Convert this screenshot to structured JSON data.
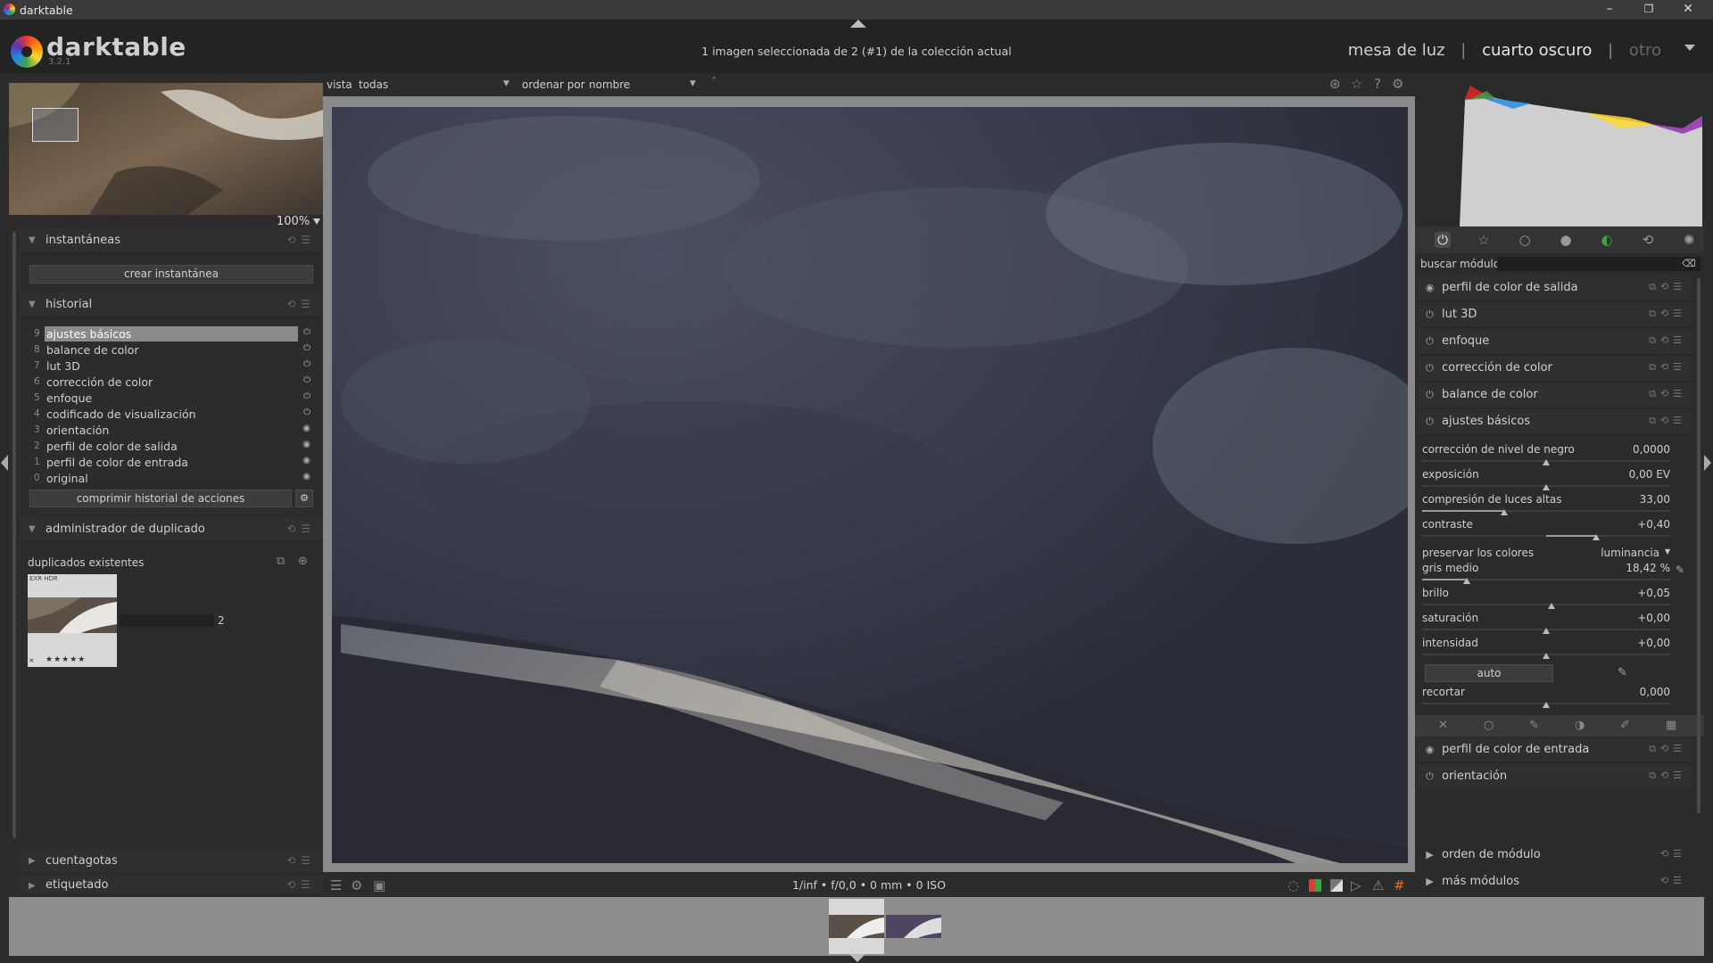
{
  "window": {
    "title": "darktable",
    "min": "–",
    "restore": "❐",
    "close": "✕"
  },
  "header": {
    "brand": "darktable",
    "version": "3.2.1",
    "collection_info": "1 imagen seleccionada de 2 (#1) de la colección actual",
    "views": {
      "lighttable": "mesa de luz",
      "separator": "|",
      "darkroom": "cuarto oscuro",
      "other": "otro"
    }
  },
  "navigator": {
    "zoom": "100%"
  },
  "left": {
    "snapshots": {
      "title": "instantáneas",
      "create_button": "crear instantánea"
    },
    "history": {
      "title": "historial",
      "items": [
        {
          "num": "9",
          "label": "ajustes básicos",
          "selected": true
        },
        {
          "num": "8",
          "label": "balance de color"
        },
        {
          "num": "7",
          "label": "lut 3D"
        },
        {
          "num": "6",
          "label": "corrección de color"
        },
        {
          "num": "5",
          "label": "enfoque"
        },
        {
          "num": "4",
          "label": "codificado de visualización"
        },
        {
          "num": "3",
          "label": "orientación"
        },
        {
          "num": "2",
          "label": "perfil de color de salida"
        },
        {
          "num": "1",
          "label": "perfil de color de entrada"
        },
        {
          "num": "0",
          "label": "original"
        }
      ],
      "compress_button": "comprimir historial de acciones"
    },
    "duplicates": {
      "title": "administrador de duplicado",
      "existing": "duplicados existentes",
      "thumb_tag": "EXR HDR",
      "count": "2",
      "stars": "★★★★★",
      "reject": "×"
    },
    "eyedropper": {
      "title": "cuentagotas"
    },
    "tagging": {
      "title": "etiquetado"
    }
  },
  "topbar": {
    "view_label": "vista",
    "view_value": "todas",
    "sort_label": "ordenar por",
    "sort_value": "nombre",
    "sort_dir": "˄"
  },
  "exif": "1/inf • f/0,0 • 0 mm • 0 ISO",
  "right": {
    "search_label": "buscar módulo",
    "modules_top": [
      {
        "label": "perfil de color de salida",
        "icon": "◉"
      },
      {
        "label": "lut 3D",
        "icon": "⏻"
      },
      {
        "label": "enfoque",
        "icon": "⏻"
      },
      {
        "label": "corrección de color",
        "icon": "⏻"
      },
      {
        "label": "balance de color",
        "icon": "⏻"
      },
      {
        "label": "ajustes básicos",
        "icon": "⏻"
      }
    ],
    "basic": {
      "sliders": [
        {
          "name": "corrección de nivel de negro",
          "value": "0,0000",
          "pos": 0.5,
          "fill": 0
        },
        {
          "name": "exposición",
          "value": "0,00 EV",
          "pos": 0.5,
          "fill": 0
        },
        {
          "name": "compresión de luces altas",
          "value": "33,00",
          "pos": 0.33,
          "fill": 0.33
        },
        {
          "name": "contraste",
          "value": "+0,40",
          "pos": 0.7,
          "fill": 0.2
        },
        {
          "name": "gris medio",
          "value": "18,42 %",
          "pos": 0.18,
          "fill": 0.18
        },
        {
          "name": "brillo",
          "value": "+0,05",
          "pos": 0.52,
          "fill": 0
        },
        {
          "name": "saturación",
          "value": "+0,00",
          "pos": 0.5,
          "fill": 0
        },
        {
          "name": "intensidad",
          "value": "+0,00",
          "pos": 0.5,
          "fill": 0
        }
      ],
      "preserve_label": "preservar los colores",
      "preserve_value": "luminancia",
      "auto_button": "auto",
      "clip_label": "recortar",
      "clip_value": "0,000"
    },
    "modules_bottom": [
      {
        "label": "perfil de color de entrada",
        "icon": "◉"
      },
      {
        "label": "orientación",
        "icon": "⏻"
      }
    ],
    "module_order": "orden de módulo",
    "more_modules": "más módulos"
  }
}
